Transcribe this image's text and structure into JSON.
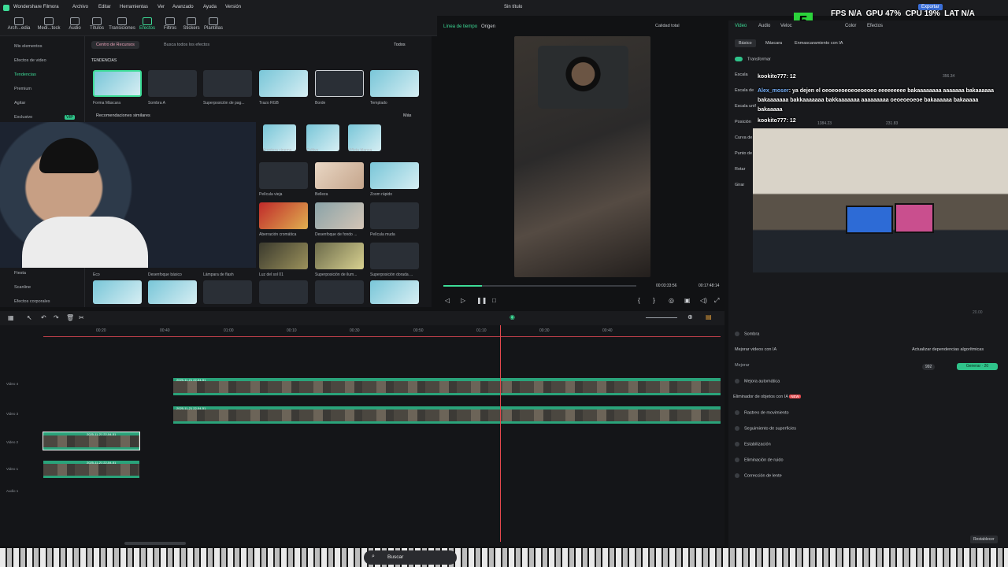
{
  "app": {
    "name": "Wondershare Filmora",
    "menu": [
      "Archivo",
      "Editar",
      "Herramientas",
      "Ver",
      "Avanzado",
      "Ayuda",
      "Versión"
    ],
    "title": "Sin título",
    "export_label": "Exportar"
  },
  "overlay_stats": {
    "fps_label": "FPS",
    "fps_value": "N/A",
    "gpu_label": "GPU",
    "gpu_value": "47%",
    "cpu_label": "CPU",
    "cpu_value": "19%",
    "lat_label": "LAT",
    "lat_value": "N/A",
    "k_number": "5"
  },
  "toolbar": [
    "Arch...edia",
    "Medi...tock",
    "Audio",
    "Títulos",
    "Transiciones",
    "Efectos",
    "Filtros",
    "Stickers",
    "Plantillas"
  ],
  "leftnav": {
    "items": [
      "Mis elementos",
      "Efectos de video",
      "Tendencias",
      "Premium",
      "Agitar",
      "Exclusivo",
      "Fiesta",
      "Scanline",
      "Efectos corporales"
    ],
    "exclusive_badge": "VIP"
  },
  "effects": {
    "resource_center": "Centro de Recursos",
    "search_placeholder": "Busca todos los efectos",
    "filter": "Todos",
    "section_title": "TENDENCIAS",
    "row1": [
      "Forma Máscara",
      "Sombra A",
      "Superposición de pag...",
      "Trazo RGB",
      "Borde",
      "Templado"
    ],
    "similar_title": "Recomendaciones similares",
    "more": "Más",
    "row2": [
      "Frontera cinema...",
      "Cultivo",
      "Viñeta blanca"
    ],
    "row3": [
      "Película vieja",
      "Belleza",
      "Zoom rápido"
    ],
    "row4": [
      "Aberración cromática",
      "Desenfoque de fondo ...",
      "Película muda"
    ],
    "row5": [
      "Eco",
      "Desenfoque básico",
      "Lámpara de flash",
      "Luz del sol 01",
      "Superposición de ilum...",
      "Superposición dorada ..."
    ]
  },
  "preview": {
    "tab_timeline": "Línea de tiempo",
    "tab_source": "Origen",
    "quality": "Calidad total",
    "current_time": "00:03:33:56",
    "total_time": "00:17:48:14",
    "progress": 0.2
  },
  "props": {
    "tabs": [
      "Video",
      "Audio",
      "Veloc",
      "Color",
      "Efectos"
    ],
    "subtabs": [
      "Básico",
      "Máscara",
      "Enmascaramiento con IA"
    ],
    "transform": "Transformar",
    "rows": [
      "Escala",
      "Escala de",
      "Escala unif",
      "Posición",
      "Curva de",
      "Punto de",
      "Rotar",
      "Girar"
    ],
    "scale_value": "356.34",
    "pos_x": "1384.23",
    "pos_y": "231.83",
    "sections": [
      "Sombra",
      "Mejorar videos con IA"
    ],
    "update_label": "Actualizar dependencias algorítmicas",
    "improve": "Mejorar",
    "credits": "992",
    "generate": "Generar",
    "generate_cost": "20",
    "ai_items": [
      "Mejora automática",
      "Eliminador de objetos con IA",
      "Rastreo de movimiento",
      "Seguimiento de superficies",
      "Estabilización",
      "Eliminación de ruido",
      "Corrección de lente"
    ],
    "new_badge": "NEW",
    "reset": "Restablecer",
    "scale_pct": "20.00"
  },
  "chat": [
    {
      "user": "kookito777",
      "msg": ": 12"
    },
    {
      "user": "Alex_moser",
      "msg": ": ya dejen el oeoeoeoeoeoeoeoeo eeeeeeeee bakaaaaaaaa aaaaaaa bakaaaaaa bakaaaaaaa bakkaaaaaaa bakkaaaaaaa aaaaaaaaa oeoeoeoeoe bakaaaaaa bakaaaaa bakaaaaa"
    },
    {
      "user": "kookito777",
      "msg": ": 12"
    }
  ],
  "timeline": {
    "ruler": [
      "00:20",
      "00:40",
      "01:00",
      "00:10",
      "00:30",
      "00:50",
      "01:10",
      "00:30",
      "00:40"
    ],
    "tracks": [
      "Video 4",
      "Video 3",
      "Video 2",
      "Video 1",
      "Audio 1"
    ],
    "clip_label": "2025-11-21 22-54-51"
  },
  "taskbar": {
    "search": "Buscar"
  },
  "colors": {
    "accent": "#3ddc97",
    "playhead": "#e5484d",
    "panel": "#18191c"
  }
}
